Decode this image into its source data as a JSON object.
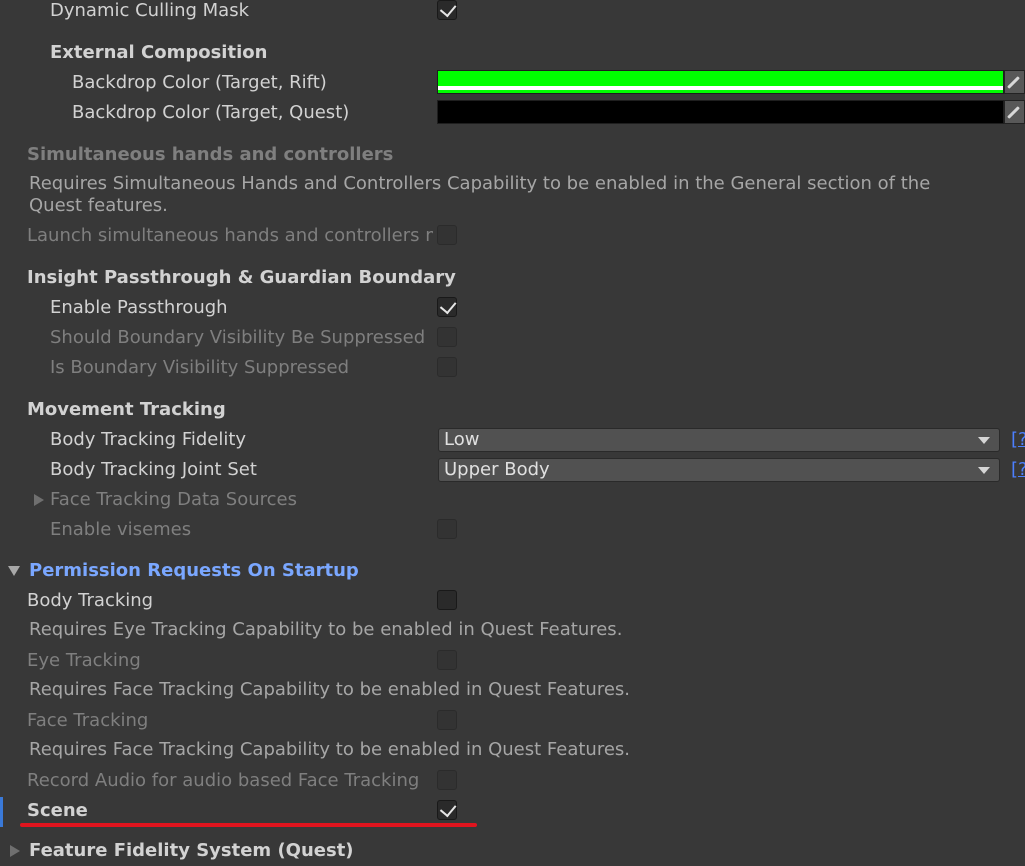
{
  "colors": {
    "accent_blue": "#7aa7ff",
    "annotation_red": "#e0141e",
    "rift_color": "#00ff00",
    "quest_color": "#000000"
  },
  "rows": {
    "dynamic_culling_mask": "Dynamic Culling Mask",
    "external_composition": "External Composition",
    "backdrop_rift": "Backdrop Color (Target, Rift)",
    "backdrop_quest": "Backdrop Color (Target, Quest)",
    "sim_hands_header": "Simultaneous hands and controllers",
    "sim_hands_help": "Requires Simultaneous Hands and Controllers Capability to be enabled in the General section of the Quest features.",
    "launch_sim_hands": "Launch simultaneous hands and controllers mo",
    "insight_header": "Insight Passthrough & Guardian Boundary",
    "enable_passthrough": "Enable Passthrough",
    "should_boundary": "Should Boundary Visibility Be Suppressed",
    "is_boundary": "Is Boundary Visibility Suppressed",
    "movement_header": "Movement Tracking",
    "body_fidelity": "Body Tracking Fidelity",
    "body_fidelity_value": "Low",
    "body_joint_set": "Body Tracking Joint Set",
    "body_joint_set_value": "Upper Body",
    "help_link": "[?",
    "face_sources": "Face Tracking Data Sources",
    "enable_visemes": "Enable visemes",
    "permission_header": "Permission Requests On Startup",
    "body_tracking": "Body Tracking",
    "eye_help": "Requires Eye Tracking Capability to be enabled in Quest Features.",
    "eye_tracking": "Eye Tracking",
    "face_help_1": "Requires Face Tracking Capability to be enabled in Quest Features.",
    "face_tracking": "Face Tracking",
    "face_help_2": "Requires Face Tracking Capability to be enabled in Quest Features.",
    "record_audio": "Record Audio for audio based Face Tracking",
    "scene": "Scene",
    "feature_fidelity": "Feature Fidelity System (Quest)"
  }
}
